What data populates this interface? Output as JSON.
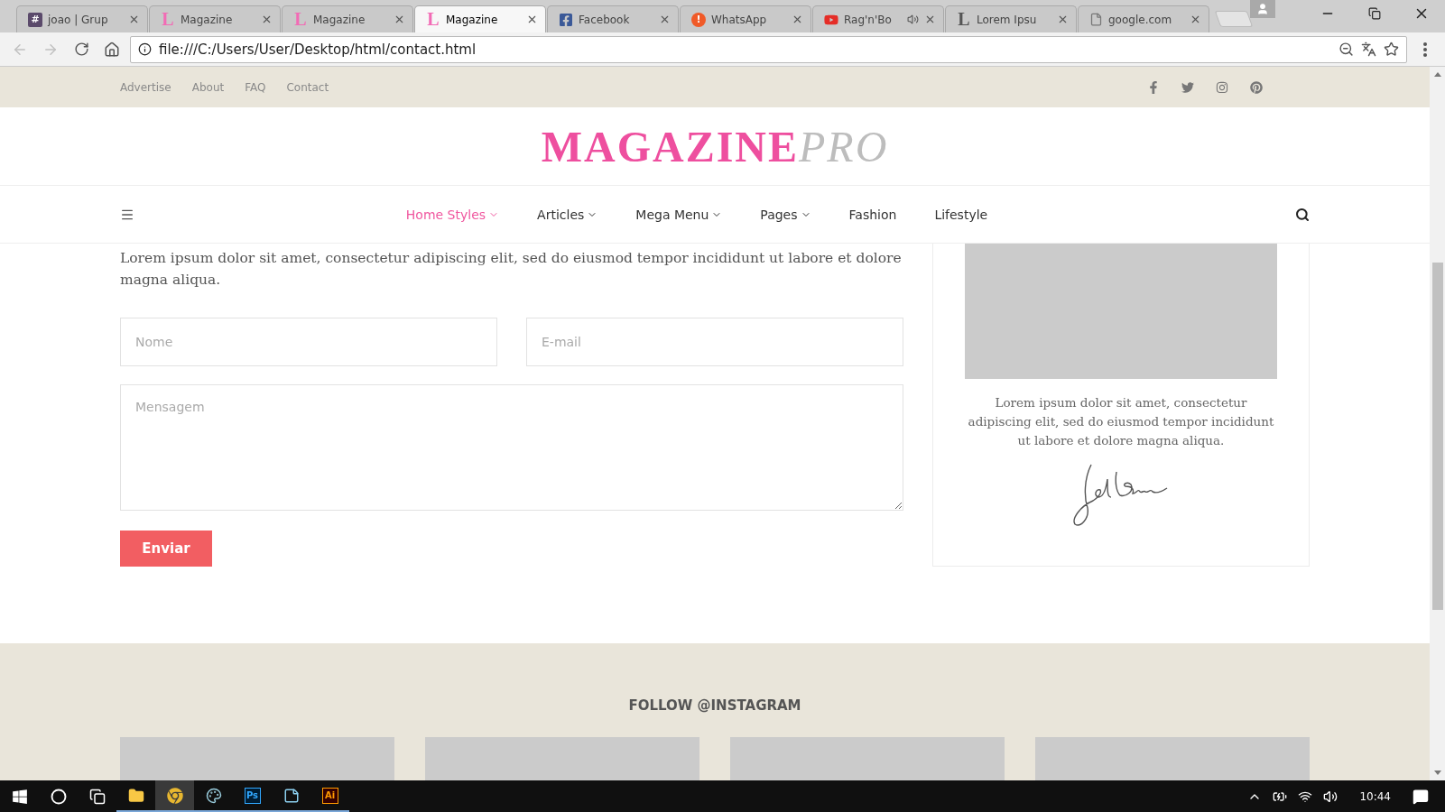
{
  "browser": {
    "tabs": [
      {
        "title": "joao | Grup",
        "favicon": {
          "kind": "hash",
          "char": "#"
        },
        "audio": false,
        "selected": false
      },
      {
        "title": "Magazine",
        "favicon": {
          "kind": "letter",
          "char": "L",
          "color": "#f26bb5"
        },
        "audio": false,
        "selected": false
      },
      {
        "title": "Magazine",
        "favicon": {
          "kind": "letter",
          "char": "L",
          "color": "#f26bb5"
        },
        "audio": false,
        "selected": false
      },
      {
        "title": "Magazine",
        "favicon": {
          "kind": "letter",
          "char": "L",
          "color": "#f26bb5"
        },
        "audio": false,
        "selected": true
      },
      {
        "title": "Facebook",
        "favicon": {
          "kind": "facebook"
        },
        "audio": false,
        "selected": false
      },
      {
        "title": "WhatsApp",
        "favicon": {
          "kind": "alert",
          "char": "!"
        },
        "audio": false,
        "selected": false
      },
      {
        "title": "Rag'n'Bo",
        "favicon": {
          "kind": "youtube"
        },
        "audio": true,
        "selected": false
      },
      {
        "title": "Lorem Ipsu",
        "favicon": {
          "kind": "letter",
          "char": "L",
          "color": "#555555"
        },
        "audio": false,
        "selected": false
      },
      {
        "title": "google.com",
        "favicon": {
          "kind": "document"
        },
        "audio": false,
        "selected": false
      }
    ],
    "back_disabled": true,
    "forward_disabled": true,
    "url": "file:///C:/Users/User/Desktop/html/contact.html"
  },
  "page": {
    "top_links": [
      "Advertise",
      "About",
      "FAQ",
      "Contact"
    ],
    "logo": {
      "main": "MAGAZINE",
      "accent": "PRO"
    },
    "nav": [
      {
        "label": "Home Styles",
        "dropdown": true,
        "selected": true
      },
      {
        "label": "Articles",
        "dropdown": true,
        "selected": false
      },
      {
        "label": "Mega Menu",
        "dropdown": true,
        "selected": false
      },
      {
        "label": "Pages",
        "dropdown": true,
        "selected": false
      },
      {
        "label": "Fashion",
        "dropdown": false,
        "selected": false
      },
      {
        "label": "Lifestyle",
        "dropdown": false,
        "selected": false
      }
    ],
    "intro": "Lorem ipsum dolor sit amet, consectetur adipiscing elit, sed do eiusmod tempor incididunt ut labore et dolore magna aliqua.",
    "form": {
      "name_placeholder": "Nome",
      "email_placeholder": "E-mail",
      "message_placeholder": "Mensagem",
      "submit": "Enviar"
    },
    "sidebar": {
      "text": "Lorem ipsum dolor sit amet, consectetur adipiscing elit, sed do eiusmod tempor incididunt ut labore et dolore magna aliqua."
    },
    "footer": {
      "heading": "FOLLOW @INSTAGRAM"
    }
  },
  "taskbar": {
    "apps": [
      {
        "kind": "explorer",
        "active": false
      },
      {
        "kind": "chrome",
        "active": true
      },
      {
        "kind": "paint",
        "active": false
      },
      {
        "kind": "photoshop",
        "label": "Ps",
        "active": false
      },
      {
        "kind": "notepad",
        "active": false
      },
      {
        "kind": "illustrator",
        "label": "Ai",
        "active": false
      }
    ],
    "time": "10:44"
  }
}
